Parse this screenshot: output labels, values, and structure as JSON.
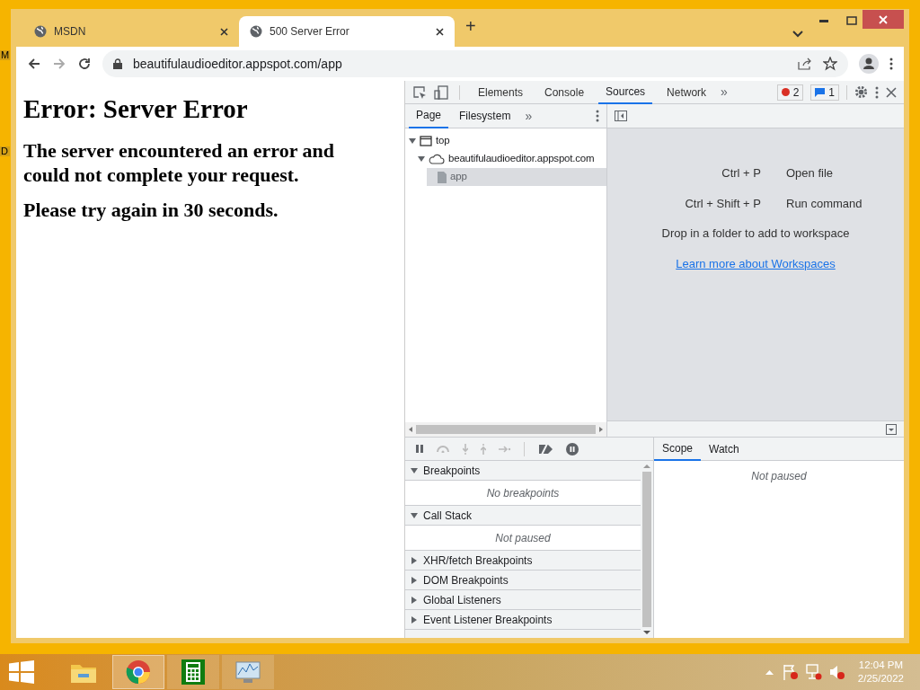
{
  "desktop": {
    "icon_labels": [
      "M",
      "D"
    ]
  },
  "browser": {
    "tabs": [
      {
        "title": "MSDN",
        "selected": false
      },
      {
        "title": "500 Server Error",
        "selected": true
      }
    ],
    "new_tab": "+",
    "address": "beautifulaudioeditor.appspot.com/app"
  },
  "page": {
    "heading": "Error: Server Error",
    "paragraphs": [
      "The server encountered an error and could not complete your request.",
      "Please try again in 30 seconds."
    ]
  },
  "devtools": {
    "tabs": [
      {
        "label": "Elements",
        "selected": false
      },
      {
        "label": "Console",
        "selected": false
      },
      {
        "label": "Sources",
        "selected": true
      },
      {
        "label": "Network",
        "selected": false
      }
    ],
    "more": "»",
    "errors": "2",
    "messages": "1",
    "navigator_tabs": [
      {
        "label": "Page",
        "selected": true
      },
      {
        "label": "Filesystem",
        "selected": false
      }
    ],
    "navigator_more": "»",
    "tree": [
      {
        "label": "top",
        "kind": "frame",
        "expanded": true,
        "selected": false,
        "children": [
          {
            "label": "beautifulaudioeditor.appspot.com",
            "kind": "domain",
            "expanded": true,
            "selected": false,
            "children": [
              {
                "label": "app",
                "kind": "file",
                "selected": true
              }
            ]
          }
        ]
      }
    ],
    "shortcuts": [
      {
        "keys": "Ctrl + P",
        "action": "Open file"
      },
      {
        "keys": "Ctrl + Shift + P",
        "action": "Run command"
      }
    ],
    "workspace_hint": "Drop in a folder to add to workspace",
    "workspace_link": "Learn more about Workspaces",
    "sections": [
      {
        "title": "Breakpoints",
        "expanded": true,
        "empty": "No breakpoints"
      },
      {
        "title": "Call Stack",
        "expanded": true,
        "empty": "Not paused"
      },
      {
        "title": "XHR/fetch Breakpoints",
        "expanded": false
      },
      {
        "title": "DOM Breakpoints",
        "expanded": false
      },
      {
        "title": "Global Listeners",
        "expanded": false
      },
      {
        "title": "Event Listener Breakpoints",
        "expanded": false
      }
    ],
    "scope_tabs": [
      {
        "label": "Scope",
        "selected": true
      },
      {
        "label": "Watch",
        "selected": false
      }
    ],
    "scope_empty": "Not paused"
  },
  "taskbar": {
    "apps": [
      {
        "kind": "explorer",
        "selected": false
      },
      {
        "kind": "chrome",
        "selected": true
      },
      {
        "kind": "calculator",
        "selected": false
      },
      {
        "kind": "monitor",
        "selected": false
      }
    ],
    "time": "12:04 PM",
    "date": "2/25/2022"
  }
}
